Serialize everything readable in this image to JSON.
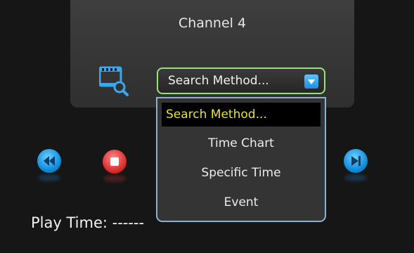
{
  "panel": {
    "channel_label": "Channel 4"
  },
  "search": {
    "selected": "Search Method...",
    "options": [
      "Search Method...",
      "Time Chart",
      "Specific Time",
      "Event"
    ]
  },
  "play_time": {
    "label": "Play Time: ------"
  },
  "colors": {
    "select_border": "#9be07a",
    "dropdown_border": "#8fb0cc",
    "selected_option_text": "#e9e23a",
    "playback_blue": "#1a8fe0",
    "stop_red": "#d62b2b"
  },
  "icons": [
    "video-search-icon",
    "chevron-down-icon",
    "rewind-icon",
    "stop-icon",
    "next-icon"
  ]
}
